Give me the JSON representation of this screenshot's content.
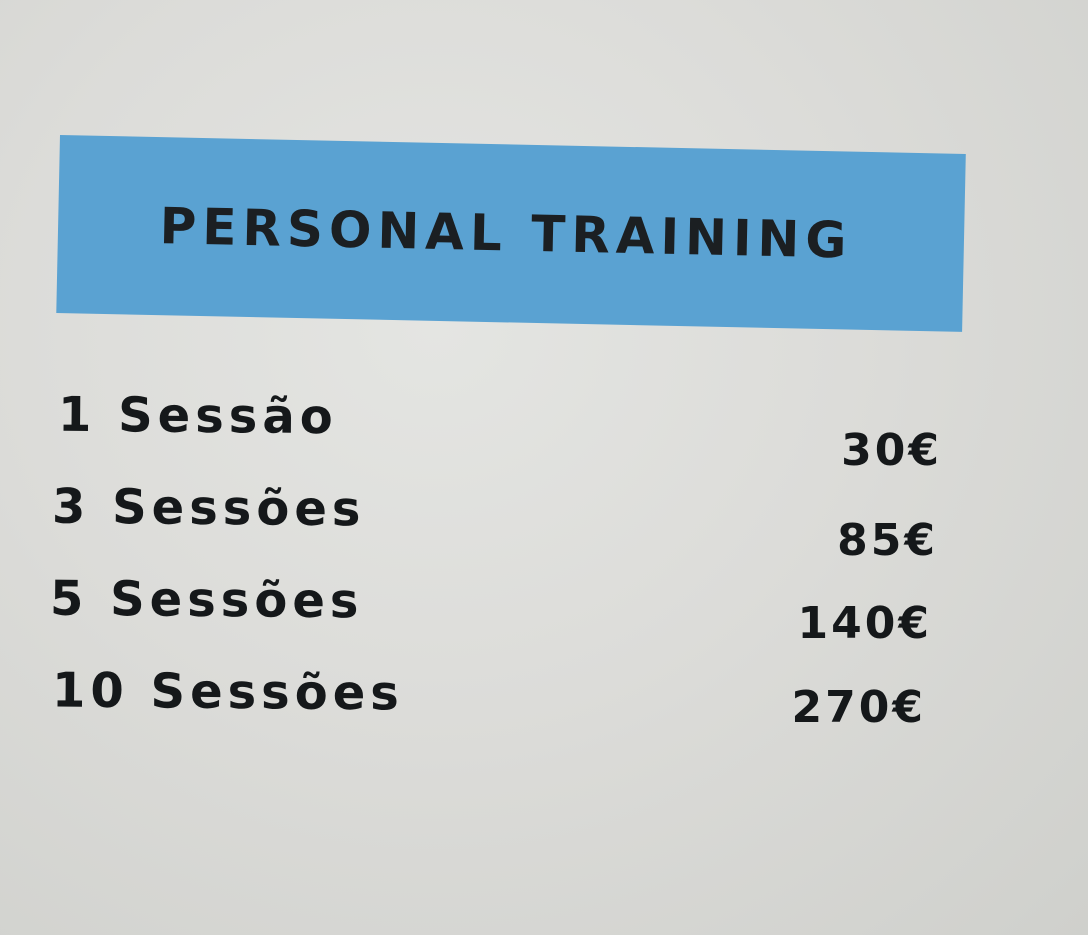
{
  "header": {
    "title": "PERSONAL TRAINING",
    "band_color": "#5aa2d2"
  },
  "price_list": [
    {
      "label": "1 Sessão",
      "price": "30€"
    },
    {
      "label": "3 Sessões",
      "price": "85€"
    },
    {
      "label": "5 Sessões",
      "price": "140€"
    },
    {
      "label": "10 Sessões",
      "price": "270€"
    }
  ]
}
